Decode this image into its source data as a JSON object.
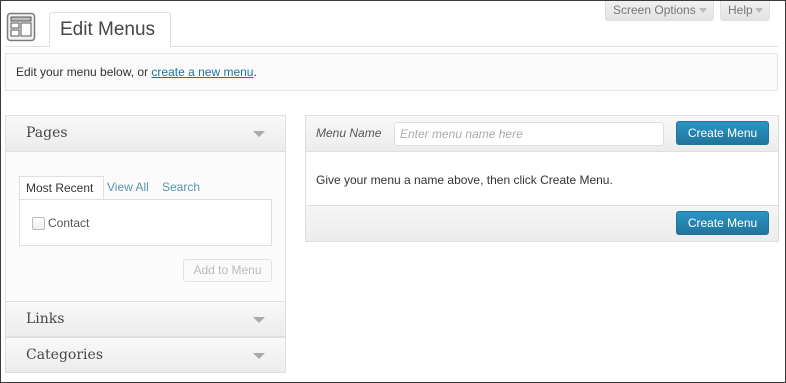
{
  "header": {
    "title": "Edit Menus",
    "page_icon": "menu-layout-icon",
    "screen_options_label": "Screen Options",
    "help_label": "Help"
  },
  "notice": {
    "prefix": "Edit your menu below, or ",
    "link": "create a new menu",
    "suffix": "."
  },
  "sidebar": {
    "pages": {
      "title": "Pages",
      "tabs": [
        "Most Recent",
        "View All",
        "Search"
      ],
      "items": [
        {
          "label": "Contact",
          "checked": false
        }
      ],
      "add_button": "Add to Menu"
    },
    "links": {
      "title": "Links"
    },
    "categories": {
      "title": "Categories"
    }
  },
  "menu_editor": {
    "name_label": "Menu Name",
    "name_value": "",
    "name_placeholder": "Enter menu name here",
    "create_button": "Create Menu",
    "message": "Give your menu a name above, then click Create Menu."
  },
  "colors": {
    "primary_button": "#21759b",
    "link": "#21759b",
    "border": "#dfdfdf"
  }
}
